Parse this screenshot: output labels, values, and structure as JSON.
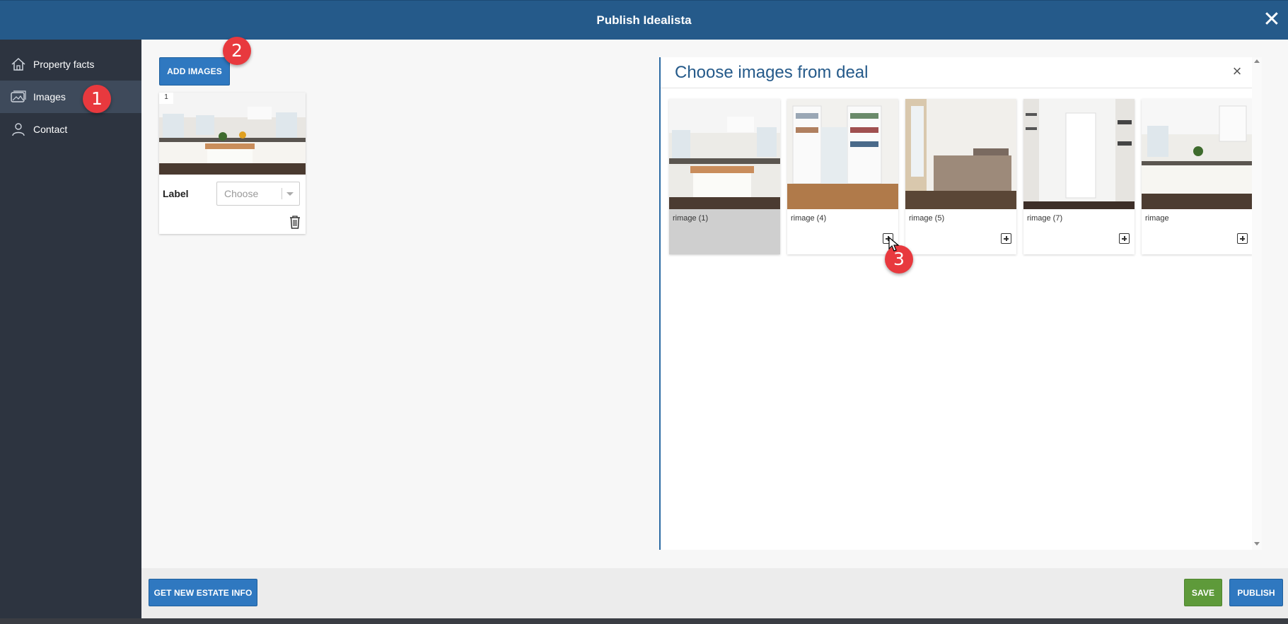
{
  "header": {
    "title": "Publish Idealista",
    "close_icon": "close-icon"
  },
  "sidebar": {
    "items": [
      {
        "label": "Property facts",
        "icon": "home-icon",
        "active": false
      },
      {
        "label": "Images",
        "icon": "images-icon",
        "active": true
      },
      {
        "label": "Contact",
        "icon": "user-icon",
        "active": false
      }
    ]
  },
  "main": {
    "add_images_label": "ADD IMAGES",
    "image_card": {
      "index": "1",
      "label": "Label",
      "select_placeholder": "Choose"
    }
  },
  "panel": {
    "title": "Choose images from deal",
    "images": [
      {
        "name": "rimage (1)",
        "selected": true
      },
      {
        "name": "rimage (4)",
        "selected": false
      },
      {
        "name": "rimage (5)",
        "selected": false
      },
      {
        "name": "rimage (7)",
        "selected": false
      },
      {
        "name": "rimage",
        "selected": false
      }
    ]
  },
  "footer": {
    "get_info_label": "GET NEW ESTATE INFO",
    "save_label": "SAVE",
    "publish_label": "PUBLISH"
  },
  "annotations": {
    "badge1": "1",
    "badge2": "2",
    "badge3": "3"
  },
  "colors": {
    "header": "#255a8a",
    "sidebar": "#2d3440",
    "primary_button": "#2f78c0",
    "save_button": "#5e9a3a",
    "badge": "#e8393e"
  }
}
